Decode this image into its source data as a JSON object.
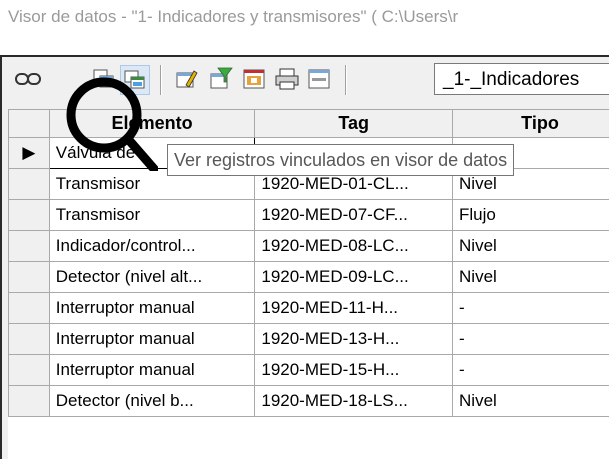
{
  "window": {
    "title": "Visor de datos - \"1- Indicadores y transmisores\" ( C:\\Users\\r"
  },
  "toolbar": {
    "buttons": [
      {
        "name": "link-icon"
      },
      {
        "name": "copy-records-icon"
      },
      {
        "name": "linked-records-icon"
      },
      {
        "name": "edit-icon"
      },
      {
        "name": "filter-icon"
      },
      {
        "name": "report-icon"
      },
      {
        "name": "print-icon"
      },
      {
        "name": "form-icon"
      }
    ],
    "view_select_value": "_1-_Indicadores"
  },
  "table": {
    "columns": [
      "Elemento",
      "Tag",
      "Tipo"
    ],
    "rows": [
      [
        "Válvula de",
        "",
        ""
      ],
      [
        "Transmisor",
        "1920-MED-01-CL...",
        "Nivel"
      ],
      [
        "Transmisor",
        "1920-MED-07-CF...",
        "Flujo"
      ],
      [
        "Indicador/control...",
        "1920-MED-08-LC...",
        "Nivel"
      ],
      [
        "Detector (nivel alt...",
        "1920-MED-09-LC...",
        "Nivel"
      ],
      [
        "Interruptor manual",
        "1920-MED-11-H...",
        "-"
      ],
      [
        "Interruptor manual",
        "1920-MED-13-H...",
        "-"
      ],
      [
        "Interruptor manual",
        "1920-MED-15-H...",
        "-"
      ],
      [
        "Detector (nivel b...",
        "1920-MED-18-LS...",
        "Nivel"
      ]
    ],
    "current_row_marker": "▶"
  },
  "tooltip": {
    "text": "Ver registros vinculados en visor de datos"
  }
}
